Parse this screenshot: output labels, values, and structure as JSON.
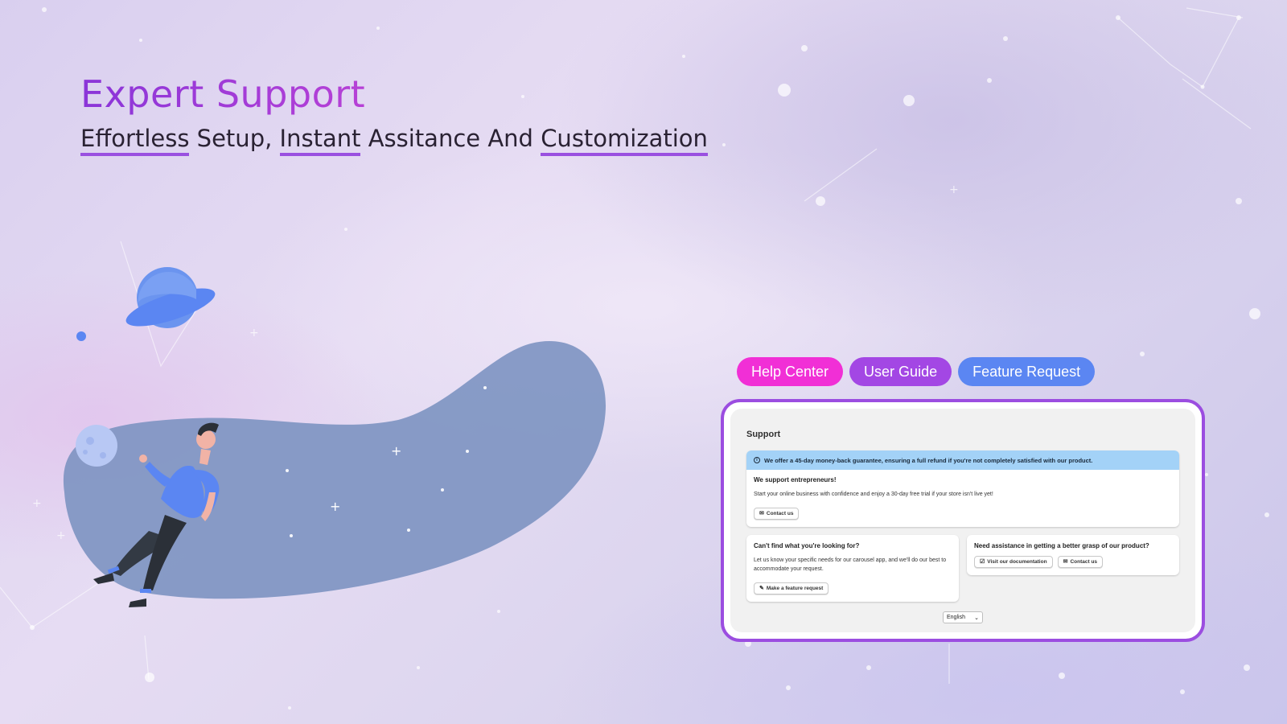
{
  "colors": {
    "heading_gradient": [
      "#8a35d8",
      "#c043d6",
      "#e46fc4"
    ],
    "underline": "#9a50e0",
    "frame_border": "#9b4de0",
    "banner_bg": "#a3d2f7",
    "blob": "#7f95c2"
  },
  "hero": {
    "title": "Expert Support",
    "subtitle": {
      "w1": "Effortless",
      "t1": " Setup, ",
      "w2": "Instant",
      "t2": " Assitance And ",
      "w3": "Customization"
    }
  },
  "tabs": [
    {
      "label": "Help Center",
      "color": "#f12fd6"
    },
    {
      "label": "User Guide",
      "color": "#a347e4"
    },
    {
      "label": "Feature Request",
      "color": "#5b86f2"
    }
  ],
  "support": {
    "title": "Support",
    "banner": {
      "icon": "info-icon",
      "text": "We offer a 45-day money-back guarantee, ensuring a full refund if you're not completely satisfied with our product."
    },
    "entrepreneurs": {
      "heading": "We support entrepreneurs!",
      "body": "Start your online business with confidence and enjoy a 30-day free trial if your store isn't live yet!",
      "button": {
        "label": "Contact us",
        "icon": "mail-icon"
      }
    },
    "feature_card": {
      "heading": "Can't find what you're looking for?",
      "body": "Let us know your specific needs for our carousel app, and we'll do our best to accommodate your request.",
      "button": {
        "label": "Make a feature request",
        "icon": "edit-icon"
      }
    },
    "docs_card": {
      "heading": "Need assistance in getting a better grasp of our product?",
      "button1": {
        "label": "Visit our documentation",
        "icon": "document-icon"
      },
      "button2": {
        "label": "Contact us",
        "icon": "mail-icon"
      }
    },
    "language": {
      "selected": "English"
    }
  }
}
